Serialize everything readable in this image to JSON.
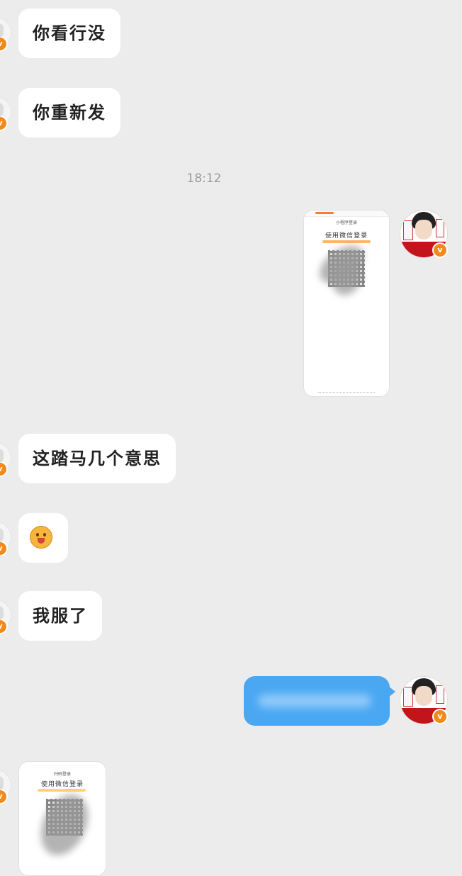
{
  "messages": {
    "m1": "你看行没",
    "m2": "你重新发",
    "timestamp": "18:12",
    "m3": "这踏马几个意思",
    "m4": "我服了"
  },
  "image_message_right": {
    "title": "小程序登录",
    "heading": "使用微信登录"
  },
  "image_message_left": {
    "title": "扫码登录",
    "heading": "使用微信登录"
  },
  "badge_icon": "verified-v-icon",
  "colors": {
    "background": "#ececec",
    "sent_bubble": "#4aa7f2",
    "badge": "#f08a1c"
  }
}
